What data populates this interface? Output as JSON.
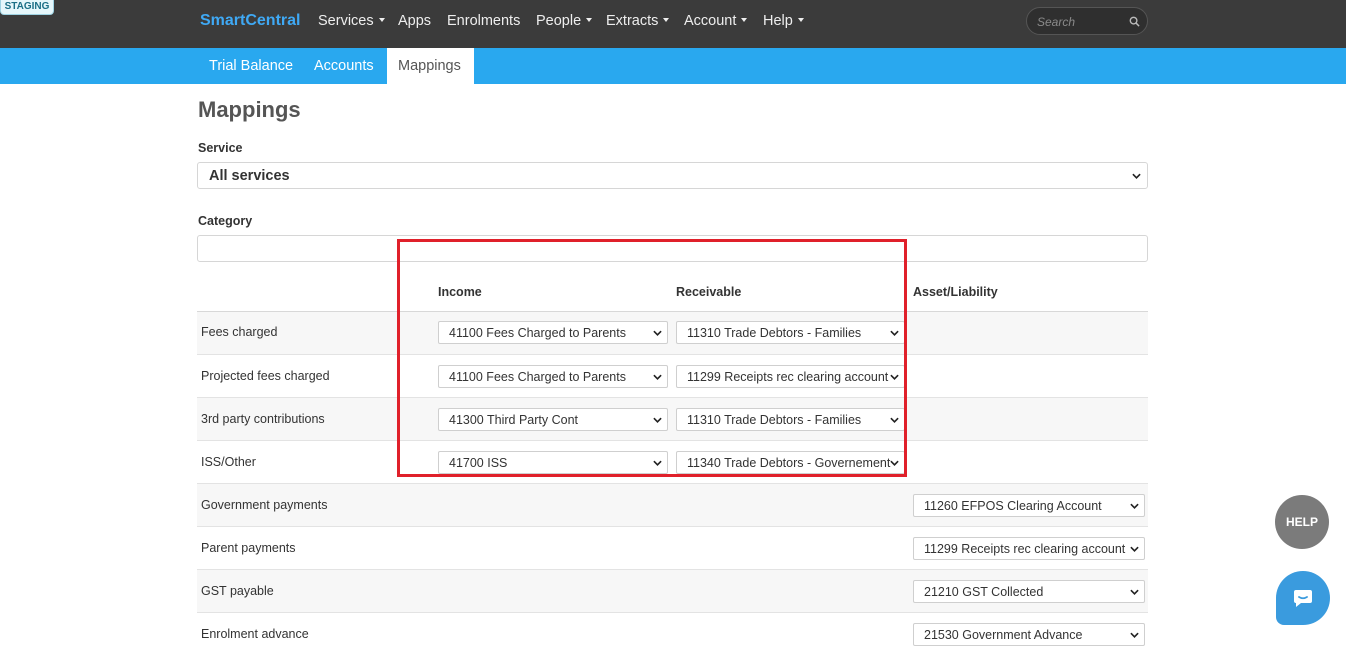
{
  "staging_badge": "STAGING",
  "topnav": {
    "brand": "SmartCentral",
    "items": [
      {
        "label": "Services",
        "dropdown": true
      },
      {
        "label": "Apps",
        "dropdown": false
      },
      {
        "label": "Enrolments",
        "dropdown": false
      },
      {
        "label": "People",
        "dropdown": true
      },
      {
        "label": "Extracts",
        "dropdown": true
      },
      {
        "label": "Account",
        "dropdown": true
      },
      {
        "label": "Help",
        "dropdown": true
      }
    ],
    "search": {
      "placeholder": "Search",
      "icon": "search-icon"
    }
  },
  "subnav": {
    "tabs": [
      {
        "label": "Trial Balance",
        "active": false
      },
      {
        "label": "Accounts",
        "active": false
      },
      {
        "label": "Mappings",
        "active": true
      }
    ]
  },
  "page": {
    "title": "Mappings",
    "service": {
      "label": "Service",
      "value": "All services"
    },
    "category": {
      "label": "Category",
      "value": ""
    }
  },
  "table": {
    "headers": {
      "income": "Income",
      "receivable": "Receivable",
      "asset_liability": "Asset/Liability"
    },
    "rows": [
      {
        "label": "Fees charged",
        "income": "41100 Fees Charged to Parents",
        "receivable": "11310 Trade Debtors - Families",
        "asset": ""
      },
      {
        "label": "Projected fees charged",
        "income": "41100 Fees Charged to Parents",
        "receivable": "11299 Receipts rec clearing account",
        "asset": ""
      },
      {
        "label": "3rd party contributions",
        "income": "41300 Third Party Cont",
        "receivable": "11310 Trade Debtors - Families",
        "asset": ""
      },
      {
        "label": "ISS/Other",
        "income": "41700 ISS",
        "receivable": "11340 Trade Debtors - Governement",
        "asset": ""
      },
      {
        "label": "Government payments",
        "income": "",
        "receivable": "",
        "asset": "11260 EFPOS Clearing Account"
      },
      {
        "label": "Parent payments",
        "income": "",
        "receivable": "",
        "asset": "11299 Receipts rec clearing account"
      },
      {
        "label": "GST payable",
        "income": "",
        "receivable": "",
        "asset": "21210 GST Collected"
      },
      {
        "label": "Enrolment advance",
        "income": "",
        "receivable": "",
        "asset": "21530 Government Advance"
      }
    ]
  },
  "floating": {
    "help_label": "HELP",
    "chat_icon": "chat-icon"
  },
  "colors": {
    "topbar": "#3b3b3b",
    "subbar": "#29a8ef",
    "brand": "#3fa9f5",
    "highlight": "#e0202a"
  }
}
